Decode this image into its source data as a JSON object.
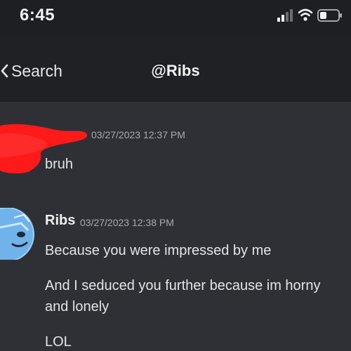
{
  "status_bar": {
    "time": "6:45",
    "icons": [
      "signal-icon",
      "wifi-icon",
      "battery-icon"
    ]
  },
  "nav": {
    "back_label": "Search",
    "back_icon": "chevron-left-icon",
    "title": "@Ribs"
  },
  "messages": [
    {
      "author": "",
      "author_redacted": true,
      "timestamp": "03/27/2023 12:37 PM",
      "lines": [
        "bruh"
      ]
    },
    {
      "author": "Ribs",
      "avatar_icon": "avatar",
      "timestamp": "03/27/2023 12:38 PM",
      "lines": [
        "Because you were impressed by me",
        "And I seduced you further because im horny and lonely",
        "LOL"
      ]
    }
  ],
  "colors": {
    "background": "#2f3035",
    "header_background": "#202125",
    "status_background": "#1e1f22",
    "redaction": "#ff1a1a",
    "avatar_blue": "#6fb3ea",
    "timestamp": "#a9aab0"
  }
}
